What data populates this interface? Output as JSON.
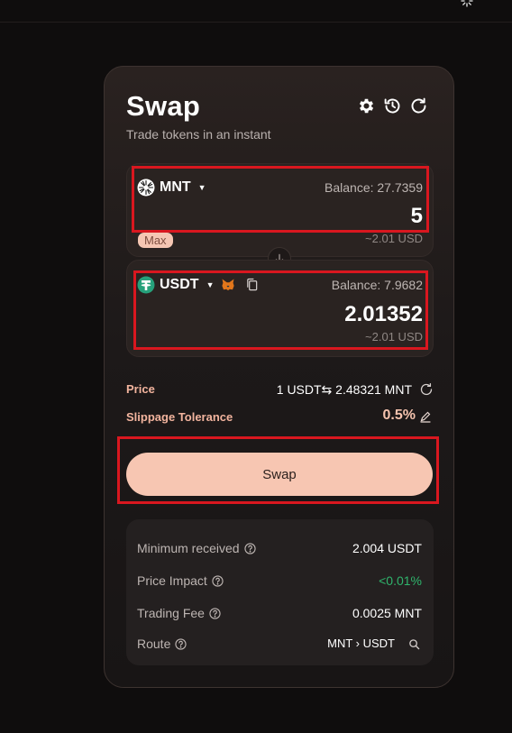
{
  "swap": {
    "title": "Swap",
    "subtitle": "Trade tokens in an instant"
  },
  "from": {
    "token": "MNT",
    "balance": "Balance: 27.7359",
    "amount": "5",
    "usd": "~2.01 USD",
    "max_label": "Max"
  },
  "to": {
    "token": "USDT",
    "balance": "Balance: 7.9682",
    "amount": "2.01352",
    "usd": "~2.01 USD"
  },
  "price": {
    "label": "Price",
    "value": "1 USDT⇆ 2.48321 MNT"
  },
  "slippage": {
    "label": "Slippage Tolerance",
    "value": "0.5%"
  },
  "swap_button": "Swap",
  "details": {
    "min_received_label": "Minimum received",
    "min_received_value": "2.004 USDT",
    "price_impact_label": "Price Impact",
    "price_impact_value": "<0.01%",
    "trading_fee_label": "Trading Fee",
    "trading_fee_value": "0.0025 MNT",
    "route_label": "Route",
    "route_value": "MNT › USDT"
  },
  "colors": {
    "accent": "#f7c6b2",
    "highlight": "#d9171f",
    "positive": "#2fb46c",
    "tether": "#26a17b"
  },
  "icons": [
    "settings-icon",
    "history-icon",
    "refresh-icon",
    "mnt-token-icon",
    "usdt-token-icon",
    "metamask-icon",
    "copy-icon",
    "arrow-down-icon",
    "edit-icon",
    "help-icon",
    "search-icon"
  ]
}
